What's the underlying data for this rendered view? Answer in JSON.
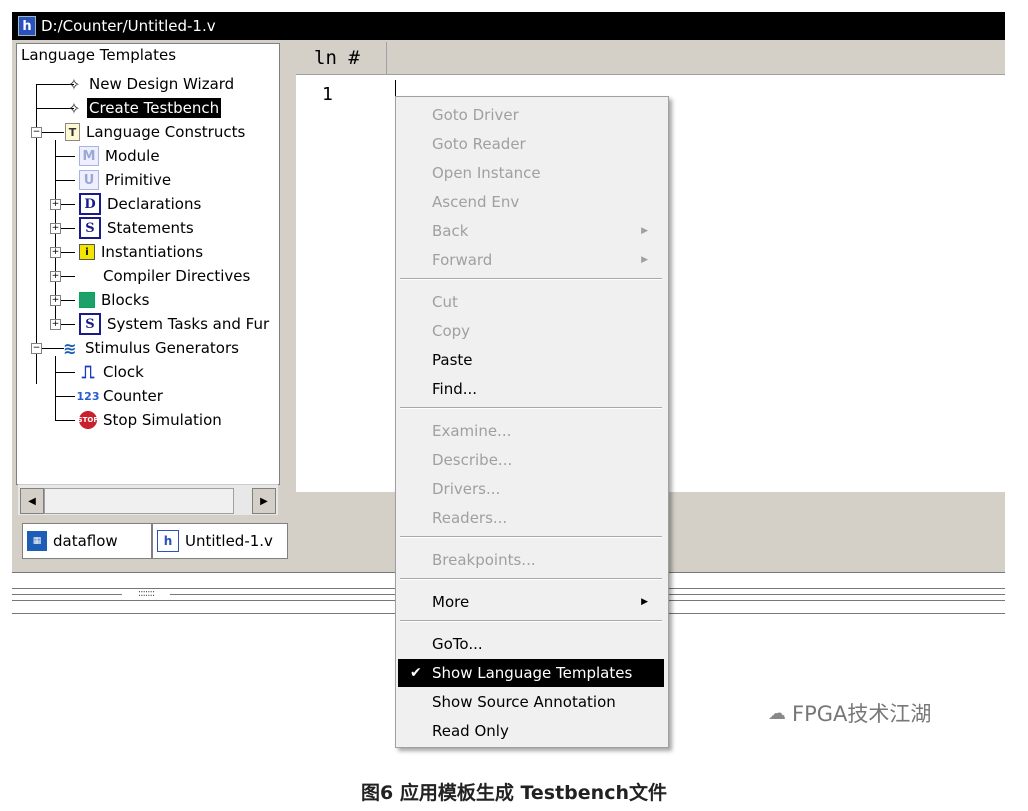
{
  "window": {
    "title": "D:/Counter/Untitled-1.v",
    "icon": "h"
  },
  "templates_pane": {
    "header": "Language Templates",
    "items": [
      {
        "label": "New Design Wizard",
        "icon": "wand-icon"
      },
      {
        "label": "Create Testbench",
        "icon": "wand-icon",
        "selected": true
      },
      {
        "label": "Language Constructs",
        "icon": "page-icon",
        "expandable": true
      },
      {
        "label": "Module",
        "icon": "M"
      },
      {
        "label": "Primitive",
        "icon": "U"
      },
      {
        "label": "Declarations",
        "icon": "D",
        "expandable": true
      },
      {
        "label": "Statements",
        "icon": "S",
        "expandable": true
      },
      {
        "label": "Instantiations",
        "icon": "instantiation-icon",
        "expandable": true
      },
      {
        "label": "Compiler Directives",
        "icon": "",
        "expandable": true
      },
      {
        "label": "Blocks",
        "icon": "blocks-icon",
        "expandable": true
      },
      {
        "label": "System Tasks and Fur",
        "icon": "S",
        "expandable": true
      },
      {
        "label": "Stimulus Generators",
        "icon": "waveform-icon",
        "expandable": true
      },
      {
        "label": "Clock",
        "icon": "clock-icon"
      },
      {
        "label": "Counter",
        "icon": "counter-icon",
        "icon_text": "123"
      },
      {
        "label": "Stop Simulation",
        "icon": "stop-icon",
        "icon_text": "STOP"
      }
    ]
  },
  "tabs": [
    {
      "label": "dataflow",
      "icon": "dataflow-icon"
    },
    {
      "label": "Untitled-1.v",
      "icon": "h"
    }
  ],
  "editor": {
    "column_headers": [
      "ln",
      "#"
    ],
    "lines": [
      "1"
    ]
  },
  "context_menu": {
    "groups": [
      [
        {
          "label": "Goto Driver",
          "enabled": false
        },
        {
          "label": "Goto Reader",
          "enabled": false
        },
        {
          "label": "Open Instance",
          "enabled": false
        },
        {
          "label": "Ascend Env",
          "enabled": false
        },
        {
          "label": "Back",
          "enabled": false,
          "submenu": true
        },
        {
          "label": "Forward",
          "enabled": false,
          "submenu": true
        }
      ],
      [
        {
          "label": "Cut",
          "enabled": false
        },
        {
          "label": "Copy",
          "enabled": false
        },
        {
          "label": "Paste",
          "enabled": true
        },
        {
          "label": "Find...",
          "enabled": true
        }
      ],
      [
        {
          "label": "Examine...",
          "enabled": false
        },
        {
          "label": "Describe...",
          "enabled": false
        },
        {
          "label": "Drivers...",
          "enabled": false
        },
        {
          "label": "Readers...",
          "enabled": false
        }
      ],
      [
        {
          "label": "Breakpoints...",
          "enabled": false
        }
      ],
      [
        {
          "label": "More",
          "enabled": true,
          "submenu": true
        }
      ],
      [
        {
          "label": "GoTo...",
          "enabled": true
        },
        {
          "label": "Show Language Templates",
          "enabled": true,
          "checked": true,
          "highlighted": true
        },
        {
          "label": "Show Source Annotation",
          "enabled": true
        },
        {
          "label": "Read Only",
          "enabled": true
        }
      ]
    ]
  },
  "watermark": "FPGA技术江湖",
  "caption": "图6 应用模板生成 Testbench文件",
  "colors": {
    "selection": "#000000",
    "disabled_text": "#a0a0a0",
    "menu_bg": "#f0f0f0",
    "chrome": "#d4d0c8"
  }
}
